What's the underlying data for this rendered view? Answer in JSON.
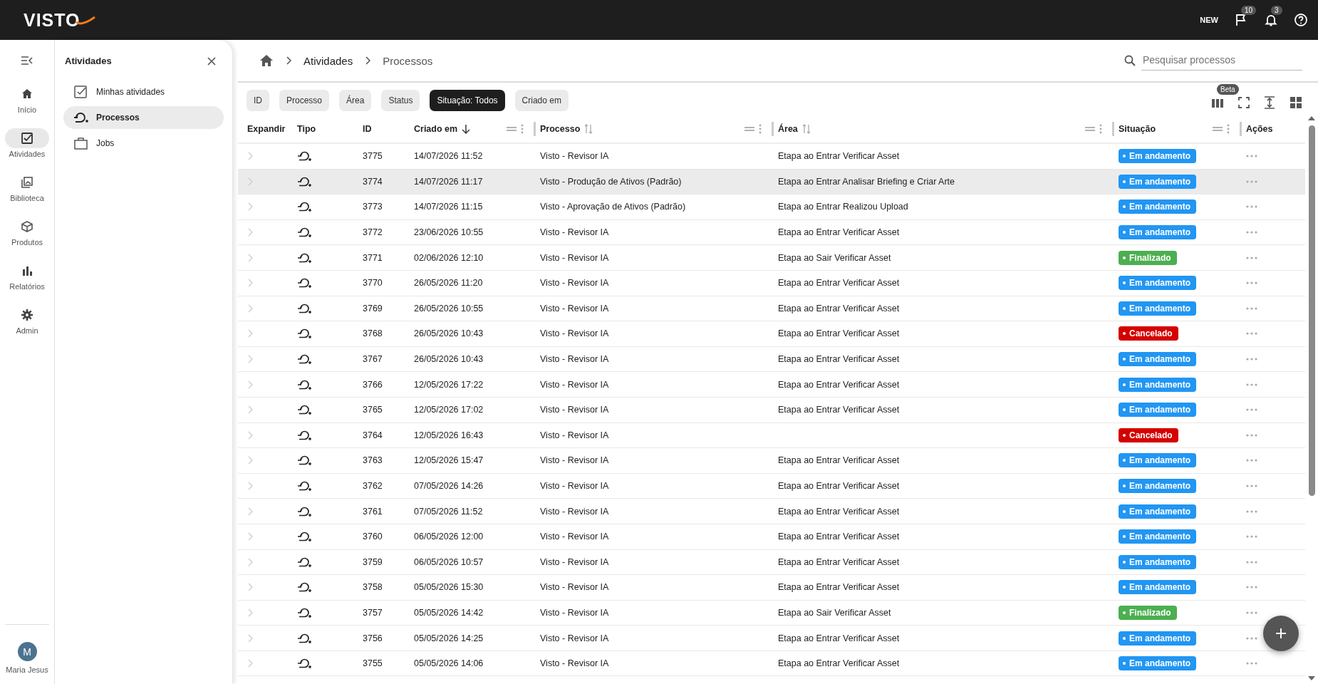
{
  "topbar": {
    "logo": "VISTO",
    "new_label": "NEW",
    "flag_badge": "10",
    "bell_badge": "3"
  },
  "rail": {
    "items": [
      {
        "label": "Início",
        "selected": false
      },
      {
        "label": "Atividades",
        "selected": true
      },
      {
        "label": "Biblioteca",
        "selected": false
      },
      {
        "label": "Produtos",
        "selected": false
      },
      {
        "label": "Relatórios",
        "selected": false
      },
      {
        "label": "Admin",
        "selected": false
      }
    ],
    "user": {
      "initial": "M",
      "name": "Maria Jesus"
    }
  },
  "panel": {
    "title": "Atividades",
    "items": [
      {
        "label": "Minhas atividades",
        "selected": false
      },
      {
        "label": "Processos",
        "selected": true
      },
      {
        "label": "Jobs",
        "selected": false
      }
    ]
  },
  "breadcrumb": [
    "Atividades",
    "Processos"
  ],
  "search": {
    "placeholder": "Pesquisar processos"
  },
  "filters": [
    {
      "label": "ID",
      "selected": false
    },
    {
      "label": "Processo",
      "selected": false
    },
    {
      "label": "Área",
      "selected": false
    },
    {
      "label": "Status",
      "selected": false
    },
    {
      "label": "Situação: Todos",
      "selected": true
    },
    {
      "label": "Criado em",
      "selected": false
    }
  ],
  "toolbar": {
    "beta_badge": "Beta"
  },
  "table": {
    "columns": [
      {
        "label": "Expandir",
        "kind": "plain"
      },
      {
        "label": "Tipo",
        "kind": "plain"
      },
      {
        "label": "ID",
        "kind": "plain"
      },
      {
        "label": "Criado em",
        "kind": "sorted"
      },
      {
        "label": "Processo",
        "kind": "sortable"
      },
      {
        "label": "Área",
        "kind": "sortable"
      },
      {
        "label": "Situação",
        "kind": "menu"
      },
      {
        "label": "Ações",
        "kind": "plain"
      }
    ],
    "rows": [
      {
        "id": "3775",
        "created": "14/07/2026 11:52",
        "process": "Visto - Revisor IA",
        "area": "Etapa ao Entrar Verificar Asset",
        "status": {
          "label": "Em andamento",
          "color": "#2196f3"
        },
        "selected": false
      },
      {
        "id": "3774",
        "created": "14/07/2026 11:17",
        "process": "Visto - Produção de Ativos (Padrão)",
        "area": "Etapa ao Entrar Analisar Briefing e Criar Arte",
        "status": {
          "label": "Em andamento",
          "color": "#2196f3"
        },
        "selected": true
      },
      {
        "id": "3773",
        "created": "14/07/2026 11:15",
        "process": "Visto - Aprovação de Ativos (Padrão)",
        "area": "Etapa ao Entrar Realizou Upload",
        "status": {
          "label": "Em andamento",
          "color": "#2196f3"
        },
        "selected": false
      },
      {
        "id": "3772",
        "created": "23/06/2026 10:55",
        "process": "Visto - Revisor IA",
        "area": "Etapa ao Entrar Verificar Asset",
        "status": {
          "label": "Em andamento",
          "color": "#2196f3"
        },
        "selected": false
      },
      {
        "id": "3771",
        "created": "02/06/2026 12:10",
        "process": "Visto - Revisor IA",
        "area": "Etapa ao Sair Verificar Asset",
        "status": {
          "label": "Finalizado",
          "color": "#4caf50"
        },
        "selected": false
      },
      {
        "id": "3770",
        "created": "26/05/2026 11:20",
        "process": "Visto - Revisor IA",
        "area": "Etapa ao Entrar Verificar Asset",
        "status": {
          "label": "Em andamento",
          "color": "#2196f3"
        },
        "selected": false
      },
      {
        "id": "3769",
        "created": "26/05/2026 10:55",
        "process": "Visto - Revisor IA",
        "area": "Etapa ao Entrar Verificar Asset",
        "status": {
          "label": "Em andamento",
          "color": "#2196f3"
        },
        "selected": false
      },
      {
        "id": "3768",
        "created": "26/05/2026 10:43",
        "process": "Visto - Revisor IA",
        "area": "Etapa ao Entrar Verificar Asset",
        "status": {
          "label": "Cancelado",
          "color": "#d50000"
        },
        "selected": false
      },
      {
        "id": "3767",
        "created": "26/05/2026 10:43",
        "process": "Visto - Revisor IA",
        "area": "Etapa ao Entrar Verificar Asset",
        "status": {
          "label": "Em andamento",
          "color": "#2196f3"
        },
        "selected": false
      },
      {
        "id": "3766",
        "created": "12/05/2026 17:22",
        "process": "Visto - Revisor IA",
        "area": "Etapa ao Entrar Verificar Asset",
        "status": {
          "label": "Em andamento",
          "color": "#2196f3"
        },
        "selected": false
      },
      {
        "id": "3765",
        "created": "12/05/2026 17:02",
        "process": "Visto - Revisor IA",
        "area": "Etapa ao Entrar Verificar Asset",
        "status": {
          "label": "Em andamento",
          "color": "#2196f3"
        },
        "selected": false
      },
      {
        "id": "3764",
        "created": "12/05/2026 16:43",
        "process": "Visto - Revisor IA",
        "status": {
          "label": "Cancelado",
          "color": "#d50000"
        },
        "selected": false
      },
      {
        "id": "3763",
        "created": "12/05/2026 15:47",
        "process": "Visto - Revisor IA",
        "area": "Etapa ao Entrar Verificar Asset",
        "status": {
          "label": "Em andamento",
          "color": "#2196f3"
        },
        "selected": false
      },
      {
        "id": "3762",
        "created": "07/05/2026 14:26",
        "process": "Visto - Revisor IA",
        "area": "Etapa ao Entrar Verificar Asset",
        "status": {
          "label": "Em andamento",
          "color": "#2196f3"
        },
        "selected": false
      },
      {
        "id": "3761",
        "created": "07/05/2026 11:52",
        "process": "Visto - Revisor IA",
        "area": "Etapa ao Entrar Verificar Asset",
        "status": {
          "label": "Em andamento",
          "color": "#2196f3"
        },
        "selected": false
      },
      {
        "id": "3760",
        "created": "06/05/2026 12:00",
        "process": "Visto - Revisor IA",
        "area": "Etapa ao Entrar Verificar Asset",
        "status": {
          "label": "Em andamento",
          "color": "#2196f3"
        },
        "selected": false
      },
      {
        "id": "3759",
        "created": "06/05/2026 10:57",
        "process": "Visto - Revisor IA",
        "area": "Etapa ao Entrar Verificar Asset",
        "status": {
          "label": "Em andamento",
          "color": "#2196f3"
        },
        "selected": false
      },
      {
        "id": "3758",
        "created": "05/05/2026 15:30",
        "process": "Visto - Revisor IA",
        "area": "Etapa ao Entrar Verificar Asset",
        "status": {
          "label": "Em andamento",
          "color": "#2196f3"
        },
        "selected": false
      },
      {
        "id": "3757",
        "created": "05/05/2026 14:42",
        "process": "Visto - Revisor IA",
        "area": "Etapa ao Sair Verificar Asset",
        "status": {
          "label": "Finalizado",
          "color": "#4caf50"
        },
        "selected": false
      },
      {
        "id": "3756",
        "created": "05/05/2026 14:25",
        "process": "Visto - Revisor IA",
        "area": "Etapa ao Entrar Verificar Asset",
        "status": {
          "label": "Em andamento",
          "color": "#2196f3"
        },
        "selected": false
      },
      {
        "id": "3755",
        "created": "05/05/2026 14:06",
        "process": "Visto - Revisor IA",
        "area": "Etapa ao Entrar Verificar Asset",
        "status": {
          "label": "Em andamento",
          "color": "#2196f3"
        },
        "selected": false
      }
    ]
  }
}
